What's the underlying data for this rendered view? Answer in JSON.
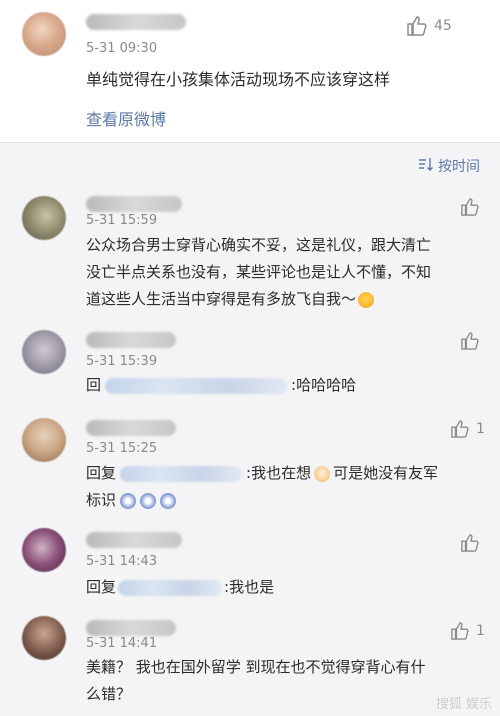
{
  "original": {
    "time": "5-31 09:30",
    "content": "单纯觉得在小孩集体活动现场不应该穿这样",
    "likes": "45",
    "view_original": "查看原微博"
  },
  "sort_label": "按时间",
  "comments": [
    {
      "time": "5-31 15:59",
      "lines": [
        "公众场合男士穿背心确实不妥，这是礼仪，跟大清亡",
        "没亡半点关系也没有，某些评论也是让人不懂，不知",
        "道这些人生活当中穿得是有多放飞自我～"
      ],
      "likes": ""
    },
    {
      "time": "5-31 15:39",
      "reply_prefix": "回",
      "reply_text": ":哈哈哈哈",
      "likes": ""
    },
    {
      "time": "5-31 15:25",
      "reply_prefix": "回复",
      "text_a": ":我也在想",
      "text_b": "可是她没有友军",
      "line2": "标识",
      "likes": "1"
    },
    {
      "time": "5-31 14:43",
      "reply_prefix": "回复",
      "reply_text": ":我也是",
      "likes": ""
    },
    {
      "time": "5-31 14:41",
      "lines": [
        "美籍？ 我也在国外留学 到现在也不觉得穿背心有什",
        "么错？"
      ],
      "likes": "1"
    }
  ],
  "watermark": "搜狐 娱乐"
}
